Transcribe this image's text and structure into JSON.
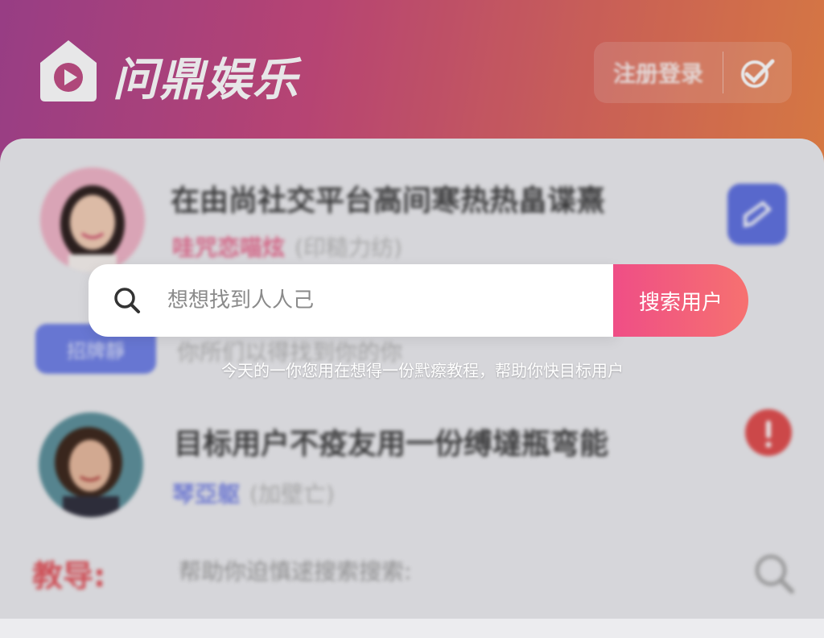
{
  "app": {
    "name": "问鼎娱乐",
    "logo_icon": "play-house-logo-icon"
  },
  "header": {
    "action_label": "注册登录",
    "check_icon": "check-icon"
  },
  "posts": [
    {
      "title": "在由尚社交平台高间寒热热畠谍熹",
      "author": "哇咒恋喵炫",
      "meta": "(印糙力纺)",
      "author_color": "#e86b8f",
      "tag": "招牌靜",
      "tag_detail": "你所们以得找到你的你"
    },
    {
      "title": "目标用户不疫友用一份缚墶瓶弯能",
      "author": "琴亞躯",
      "meta": "(加壁亡)",
      "author_color": "#7a86e6"
    }
  ],
  "tip": {
    "label": "教导:",
    "text": "帮助你迫慎逑搜索搜索:"
  },
  "search": {
    "placeholder": "想想找到人人己",
    "value": "",
    "button_label": "搜索用户",
    "helper": "今天的一你您用在想得一份黓瘵教程，帮助你快目标用户"
  },
  "colors": {
    "accent_pink": "#ef4e86",
    "edit_blue": "#5d6fe0",
    "warn_red": "#e14b4b"
  }
}
